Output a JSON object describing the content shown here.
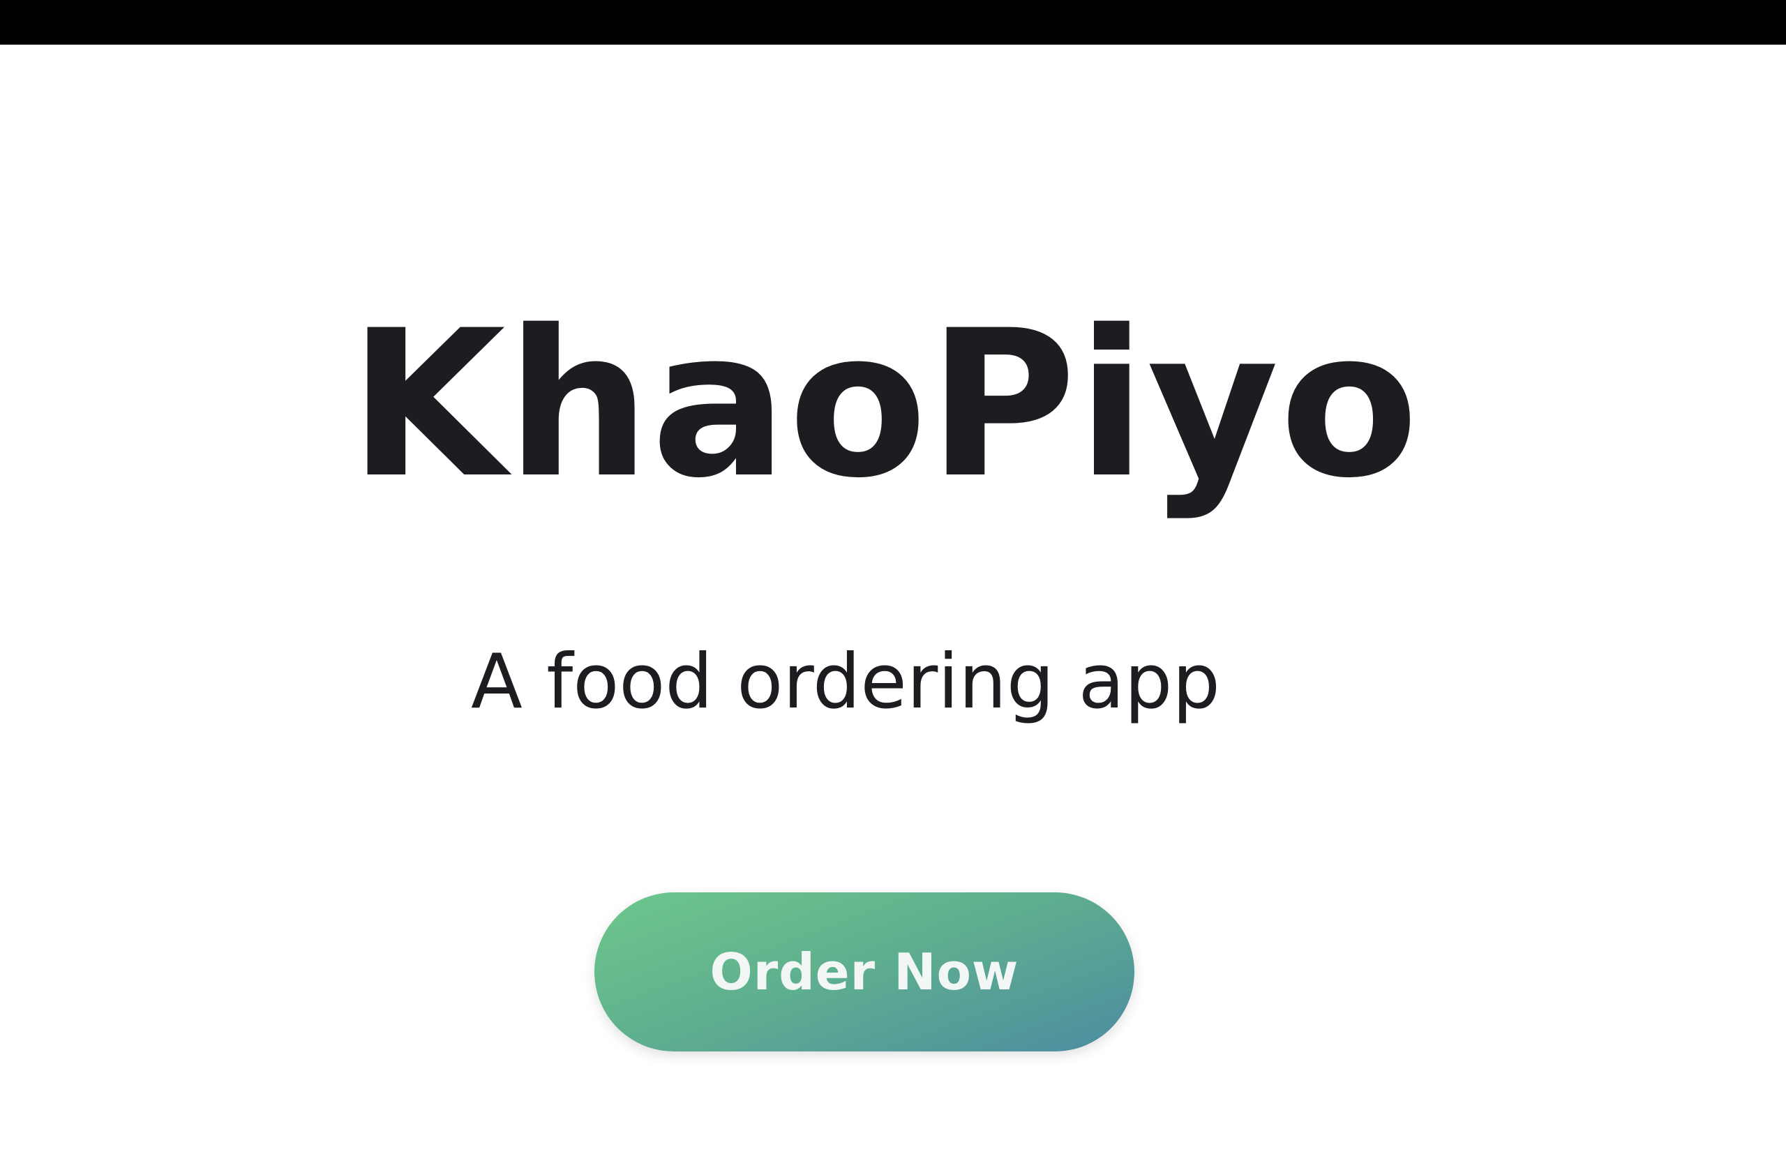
{
  "brand": {
    "title": "KhaoPiyo",
    "tagline": "A food ordering app"
  },
  "cta": {
    "label": "Order Now"
  },
  "colors": {
    "top_bar": "#000000",
    "background": "#ffffff",
    "text": "#1b1d21",
    "button_gradient_start": "#6dc78b",
    "button_gradient_end": "#4d8ca0",
    "button_text": "#f2f7f5"
  }
}
